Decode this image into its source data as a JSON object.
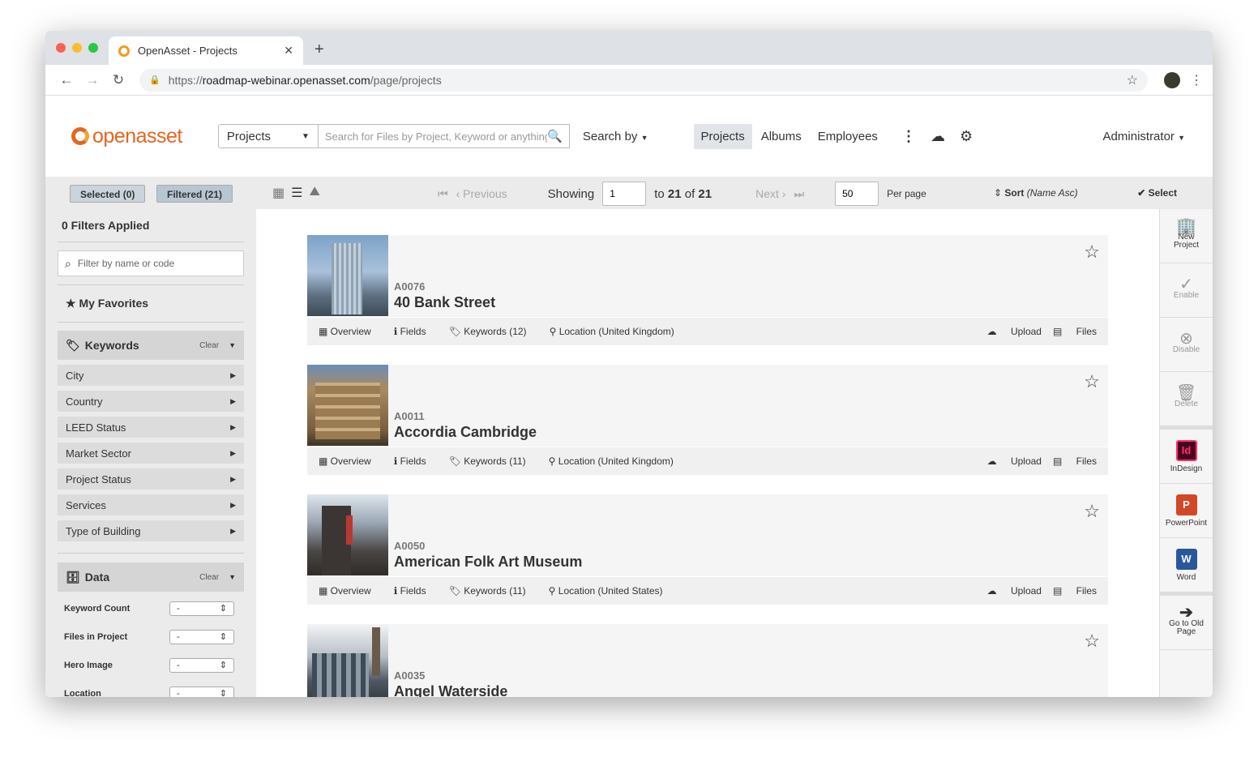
{
  "browser": {
    "tab_title": "OpenAsset - Projects",
    "url_prefix": "https://",
    "url_host": "roadmap-webinar.openasset.com",
    "url_path": "/page/projects"
  },
  "header": {
    "logo_text": "openasset",
    "scope_value": "Projects",
    "search_placeholder": "Search for Files by Project, Keyword or anything",
    "search_by_label": "Search by",
    "nav": [
      "Projects",
      "Albums",
      "Employees"
    ],
    "user_label": "Administrator"
  },
  "toolbar": {
    "selected_label": "Selected (0)",
    "filtered_label": "Filtered (21)",
    "previous_label": "Previous",
    "showing_label": "Showing",
    "page_start": "1",
    "to_label": "to",
    "range_end": "21",
    "of_label": "of",
    "total": "21",
    "next_label": "Next",
    "per_page_value": "50",
    "per_page_label": "Per page",
    "sort_label": "Sort",
    "sort_value": "(Name Asc)",
    "select_label": "Select"
  },
  "sidebar": {
    "filters_applied": "0 Filters Applied",
    "filter_placeholder": "Filter by name or code",
    "favorites_label": "My Favorites",
    "keywords_label": "Keywords",
    "clear_label": "Clear",
    "keyword_items": [
      "City",
      "Country",
      "LEED Status",
      "Market Sector",
      "Project Status",
      "Services",
      "Type of Building"
    ],
    "data_label": "Data",
    "data_rows": [
      {
        "label": "Keyword Count",
        "value": "-"
      },
      {
        "label": "Files in Project",
        "value": "-"
      },
      {
        "label": "Hero Image",
        "value": "-"
      },
      {
        "label": "Location",
        "value": "-"
      }
    ]
  },
  "projects": [
    {
      "code": "A0076",
      "name": "40 Bank Street",
      "keywords": "Keywords (12)",
      "location": "Location (United Kingdom)"
    },
    {
      "code": "A0011",
      "name": "Accordia Cambridge",
      "keywords": "Keywords (11)",
      "location": "Location (United Kingdom)"
    },
    {
      "code": "A0050",
      "name": "American Folk Art Museum",
      "keywords": "Keywords (11)",
      "location": "Location (United States)"
    },
    {
      "code": "A0035",
      "name": "Angel Waterside",
      "keywords": "",
      "location": ""
    }
  ],
  "card_actions": {
    "overview": "Overview",
    "fields": "Fields",
    "upload": "Upload",
    "files": "Files"
  },
  "rail": {
    "new_project": "New Project",
    "enable": "Enable",
    "disable": "Disable",
    "delete": "Delete",
    "indesign": "InDesign",
    "powerpoint": "PowerPoint",
    "word": "Word",
    "old_page": "Go to Old Page"
  },
  "colors": {
    "brand": "#e4661f",
    "pill": "#c9d4dd",
    "indesign": "#49021f",
    "powerpoint": "#d24726",
    "word": "#2b579a"
  }
}
